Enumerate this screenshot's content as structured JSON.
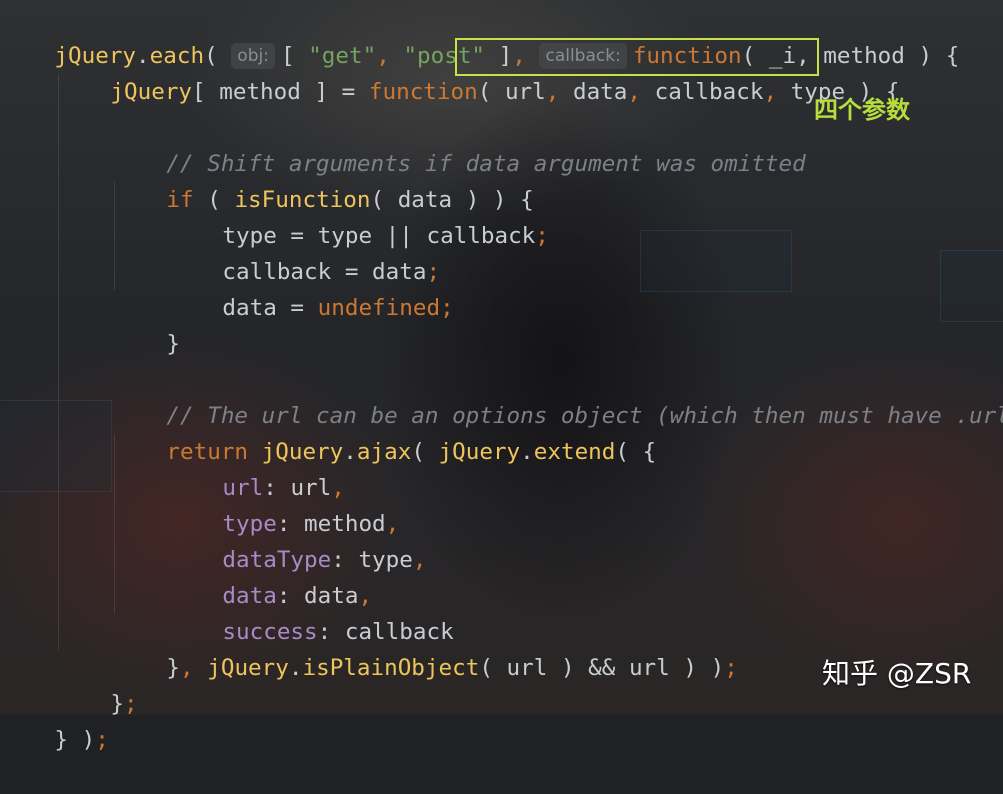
{
  "editor": {
    "hints": {
      "obj": "obj:",
      "callback": "callback:"
    },
    "lines": {
      "l1": {
        "a": "jQuery",
        "b": ".",
        "c": "each",
        "d": "( ",
        "e": "[ ",
        "f": "\"get\"",
        "g": ", ",
        "h": "\"post\"",
        "i": " ]",
        "j": ", ",
        "k": "function",
        "l": "( _i",
        "m": ", method ) {"
      },
      "l2": {
        "a": "jQuery",
        "b": "[ method ] = ",
        "c": "function",
        "d": "( ",
        "e": "url",
        "f": ", ",
        "g": "data",
        "h": ", ",
        "i": "callback",
        "j": ", ",
        "k": "type",
        "l": " ) {"
      },
      "l3": {
        "a": "// Shift arguments if data argument was omitted"
      },
      "l4": {
        "a": "if",
        "b": " ( ",
        "c": "isFunction",
        "d": "( data ) ) {"
      },
      "l5": {
        "a": "type = type || callback",
        "b": ";"
      },
      "l6": {
        "a": "callback = data",
        "b": ";"
      },
      "l7": {
        "a": "data = ",
        "b": "undefined",
        "c": ";"
      },
      "l8": {
        "a": "}"
      },
      "l9": {
        "a": "// The url can be an options object (which then must have .url)"
      },
      "l10": {
        "a": "return",
        "b": " ",
        "c": "jQuery",
        "d": ".",
        "e": "ajax",
        "f": "( ",
        "g": "jQuery",
        "h": ".",
        "i": "extend",
        "j": "( {"
      },
      "l11": {
        "a": "url",
        "b": ": url",
        "c": ","
      },
      "l12": {
        "a": "type",
        "b": ": method",
        "c": ","
      },
      "l13": {
        "a": "dataType",
        "b": ": type",
        "c": ","
      },
      "l14": {
        "a": "data",
        "b": ": data",
        "c": ","
      },
      "l15": {
        "a": "success",
        "b": ": callback"
      },
      "l16": {
        "a": "}",
        "b": ", ",
        "c": "jQuery",
        "d": ".",
        "e": "isPlainObject",
        "f": "( url ) && url ) )",
        "g": ";"
      },
      "l17": {
        "a": "}",
        "b": ";"
      },
      "l18": {
        "a": "} )",
        "b": ";"
      }
    }
  },
  "annotation": "四个参数",
  "watermark": "知乎 @ZSR",
  "colors": {
    "keyword": "#cc7832",
    "string": "#73a45f",
    "function": "#f0c45c",
    "property": "#a78bc4",
    "comment": "#7d8087",
    "highlight_box": "#c8e04a",
    "annotation": "#b6dd3c"
  }
}
